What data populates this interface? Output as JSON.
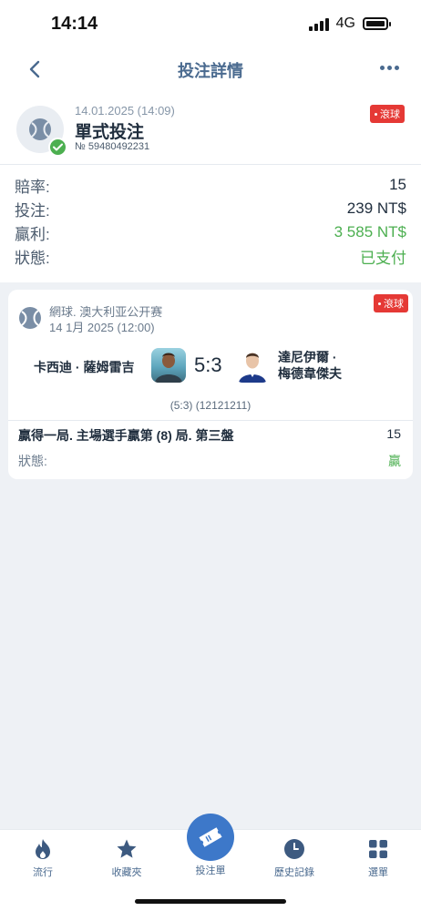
{
  "status_bar": {
    "time": "14:14",
    "network": "4G"
  },
  "header": {
    "title": "投注詳情"
  },
  "bet": {
    "date": "14.01.2025 (14:09)",
    "type": "單式投注",
    "id": "№ 59480492231",
    "live_label": "滾球",
    "rows": [
      {
        "label": "賠率:",
        "value": "15"
      },
      {
        "label": "投注:",
        "value": "239 NT$"
      },
      {
        "label": "贏利:",
        "value": "3 585 NT$"
      },
      {
        "label": "狀態:",
        "value": "已支付"
      }
    ]
  },
  "event": {
    "league": "網球. 澳大利亚公开赛",
    "time": "14 1月 2025 (12:00)",
    "live_label": "滾球",
    "home_team": "卡西迪 · 薩姆雷吉",
    "score": "5:3",
    "away_team_line1": "達尼伊爾 ·",
    "away_team_line2": "梅德韋傑夫",
    "sets": "(5:3) (12121211)",
    "market": "贏得一局. 主場選手贏第 (8) 局. 第三盤",
    "market_odds": "15",
    "status_label": "狀態:",
    "status_value": "贏"
  },
  "nav": {
    "items": [
      {
        "label": "流行"
      },
      {
        "label": "收藏夾"
      },
      {
        "label": "投注單"
      },
      {
        "label": "歷史記錄"
      },
      {
        "label": "選單"
      }
    ]
  },
  "colors": {
    "accent": "#3d78c9",
    "win": "#4caf50",
    "live": "#e53935"
  }
}
